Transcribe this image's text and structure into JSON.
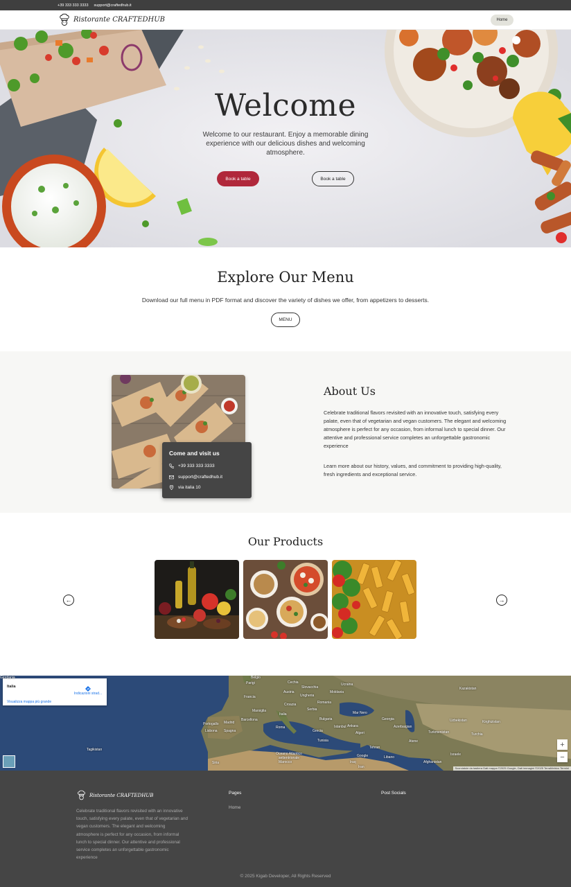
{
  "topbar": {
    "phone": "+39 333 333 3333",
    "email": "support@craftedhub.it"
  },
  "nav": {
    "brand": "Ristorante CRAFTEDHUB",
    "home": "Home",
    "logo_icon": "chef-hat-icon"
  },
  "hero": {
    "title": "Welcome",
    "subtitle": "Welcome to our restaurant. Enjoy a memorable dining experience with our delicious dishes and welcoming atmosphere.",
    "btn_primary": "Book a table",
    "btn_secondary": "Book a table"
  },
  "menu_section": {
    "title": "Explore Our Menu",
    "subtitle": "Download our full menu in PDF format and discover the variety of dishes we offer, from appetizers to desserts.",
    "button": "MENU"
  },
  "about": {
    "title": "About Us",
    "p1": "Celebrate traditional flavors revisited with an innovative touch, satisfying every palate, even that of vegetarian and vegan customers. The elegant and welcoming atmosphere is perfect for any occasion, from informal lunch to special dinner. Our attentive and professional service completes an unforgettable gastronomic experience",
    "p2": "Learn more about our history, values, and commitment to providing high-quality, fresh ingredients and exceptional service.",
    "card": {
      "title": "Come and visit us",
      "phone": "+39 333 333 3333",
      "email": "support@craftedhub.it",
      "address": "via italia 10"
    }
  },
  "products": {
    "title": "Our Products"
  },
  "map": {
    "place": "Italia",
    "directions": "Indicazioni strad...",
    "larger_map": "Visualizza mappa più grande",
    "labels": [
      "Belgio",
      "Parigi",
      "Cechia",
      "Slovacchia",
      "Ucraina",
      "Kazakistan",
      "Francia",
      "Austria",
      "Ungheria",
      "Moldavia",
      "Croazia",
      "Romania",
      "Marsiglia",
      "Serbia",
      "Mar Nero",
      "Italia",
      "Georgia",
      "Portogallo",
      "Madrid",
      "Barcellona",
      "Bulgaria",
      "Azerbaigian",
      "Uzbekistan",
      "Lisbona",
      "Spagna",
      "Roma",
      "Grecia",
      "Istanbul",
      "Ankara",
      "Turkmenistan",
      "Kirghizistan",
      "Algeri",
      "Turchia",
      "Tagikistan",
      "Oceano Atlantico settentrionale",
      "Tunisia",
      "Atene",
      "Tehran",
      "Siria",
      "Marocco",
      "Google",
      "Libano",
      "Iraq",
      "Israele",
      "Afghanistan",
      "Iran",
      "Giordania"
    ],
    "attribution": "Scorciatoie da tastiera   Dati mappa ©2025 Google, Dati immagini ©2025 TerraMetrics   Termini",
    "zoom_in": "+",
    "zoom_out": "−"
  },
  "footer": {
    "brand": "Ristorante CRAFTEDHUB",
    "description": "Celebrate traditional flavors revisited with an innovative touch, satisfying every palate, even that of vegetarian and vegan customers. The elegant and welcoming atmosphere is perfect for any occasion, from informal lunch to special dinner. Our attentive and professional service completes an unforgettable gastronomic experience",
    "pages_title": "Pages",
    "pages_link": "Home",
    "socials_title": "Post Socials",
    "copyright": "© 2025 Kigab Developer, All Rights Reserved"
  },
  "colors": {
    "accent": "#b0283b",
    "dark": "#454545",
    "topbar": "#3f3f3f",
    "pill": "#e3e3dc"
  }
}
